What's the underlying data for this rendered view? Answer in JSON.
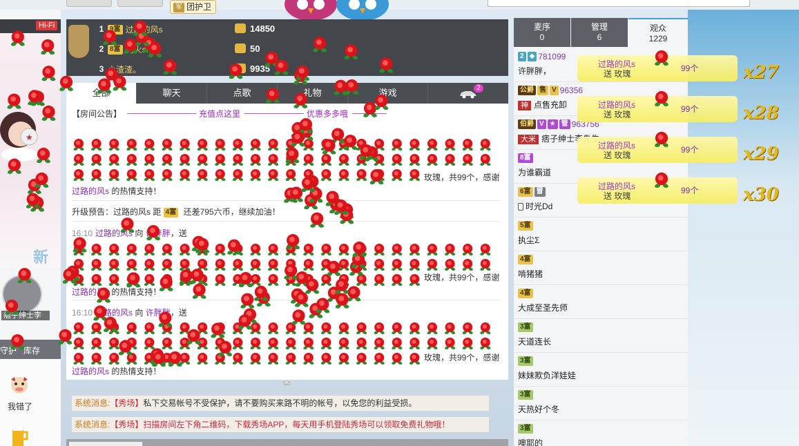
{
  "header": {
    "guard_label": "团护卫",
    "hifi_label": "Hi-Fi"
  },
  "ranking": [
    {
      "rank": "1",
      "level": "9富",
      "name": "过路的风s",
      "value": "14850"
    },
    {
      "rank": "2",
      "level": "8富",
      "name": "阿火sh",
      "value": "50"
    },
    {
      "rank": "3",
      "level": "",
      "name": "小渣渣。",
      "value": "9935"
    }
  ],
  "tabs": [
    "全部",
    "聊天",
    "点歌",
    "礼物",
    "游戏",
    ""
  ],
  "tab_badge": "2",
  "chat": {
    "notice_label": "【房间公告】",
    "notice_link1": "充值点这里",
    "notice_link2": "优惠多多哦",
    "messages": [
      {
        "tail": "玫瑰，共99个，感谢",
        "thanks_user": "过路的风s",
        "thanks_text": " 的热情支持！"
      },
      {
        "time": "16:10",
        "user": "过路的风s",
        "action": " 向 ",
        "target": "许胖胖",
        "verb": "，送",
        "tail": "玫瑰，共99个，感谢",
        "thanks_user": "过路的风s",
        "thanks_text": " 的热情支持！"
      },
      {
        "time": "16:10",
        "user": "过路的风s",
        "action": " 向 ",
        "target": "许胖胖",
        "verb": "，送",
        "tail": "玫瑰，共99个，感谢",
        "thanks_user": "过路的风s",
        "thanks_text": " 的热情支持！"
      }
    ],
    "upgrade_prefix": "升级预告：过路的风s 距 ",
    "upgrade_level": "4富",
    "upgrade_suffix": " 还差795六币，继续加油！"
  },
  "system_messages": [
    {
      "label": "系统消息:",
      "tag": "【秀场】",
      "body": "私下交易帐号不受保护，请不要购买来路不明的帐号，以免您的利益受损。"
    },
    {
      "label": "系统消息:",
      "tag": "【秀场】",
      "body": "扫描房间左下角二维码，下载秀场APP，每天用手机登陆秀场可以领取免费礼物哦！"
    }
  ],
  "left": {
    "mic_name": "痞子绅士李",
    "xin": "新",
    "bar_items": [
      "守护",
      "库存"
    ],
    "action_label": "我错了"
  },
  "right_tabs": [
    {
      "label": "麦序",
      "count": "0"
    },
    {
      "label": "管理",
      "count": "6"
    },
    {
      "label": "观众",
      "count": "1229"
    }
  ],
  "audience": [
    {
      "badges": [
        {
          "t": "2",
          "c": "b-teal"
        },
        {
          "t": "◆",
          "c": "b-teal"
        }
      ],
      "id": "781099",
      "name": "许胖胖，"
    },
    {
      "badges": [
        {
          "t": "公爵",
          "c": "b-dark"
        },
        {
          "t": "售",
          "c": "b-gold"
        },
        {
          "t": "V",
          "c": "b-gold"
        }
      ],
      "id": "96356",
      "banner": "神",
      "name": "点售充卸"
    },
    {
      "badges": [
        {
          "t": "伯爵",
          "c": "b-dark"
        },
        {
          "t": "V",
          "c": "b-purple"
        },
        {
          "t": "★",
          "c": "b-purple"
        },
        {
          "t": "管",
          "c": "b-purple"
        }
      ],
      "id": "963756",
      "banner": "大米",
      "name": "痞子绅士李先生"
    },
    {
      "badges": [
        {
          "t": "8富",
          "c": "b-purple"
        }
      ],
      "id": "",
      "name": "为谁霸道"
    },
    {
      "badges": [
        {
          "t": "6富",
          "c": "b-gold"
        },
        {
          "t": "冒",
          "c": "b-gray"
        }
      ],
      "id": "",
      "phone": true,
      "name": "时光Dd"
    },
    {
      "badges": [
        {
          "t": "5富",
          "c": "b-gold"
        }
      ],
      "id": "",
      "name": "执尘Σ"
    },
    {
      "badges": [
        {
          "t": "4富",
          "c": "b-gold"
        }
      ],
      "id": "",
      "name": "啃猪猪"
    },
    {
      "badges": [
        {
          "t": "4富",
          "c": "b-gold"
        }
      ],
      "id": "",
      "name": "大成至圣先师"
    },
    {
      "badges": [
        {
          "t": "3富",
          "c": "b-green"
        }
      ],
      "id": "",
      "name": "天道连长"
    },
    {
      "badges": [
        {
          "t": "3富",
          "c": "b-green"
        }
      ],
      "id": "",
      "name": "妹妹欺负洋娃娃"
    },
    {
      "badges": [
        {
          "t": "3富",
          "c": "b-green"
        }
      ],
      "id": "",
      "name": "天热好个冬"
    },
    {
      "badges": [
        {
          "t": "3富",
          "c": "b-green"
        }
      ],
      "id": "",
      "name": "噢耶的"
    }
  ],
  "gift_banners": [
    {
      "name": "过路的风s",
      "send": "送 玫瑰",
      "count": "99个",
      "combo": "x27"
    },
    {
      "name": "过路的风s",
      "send": "送 玫瑰",
      "count": "99个",
      "combo": "x28"
    },
    {
      "name": "过路的风s",
      "send": "送 玫瑰",
      "count": "99个",
      "combo": "x29"
    },
    {
      "name": "过路的风s",
      "send": "送 玫瑰",
      "count": "99个",
      "combo": "x30"
    }
  ],
  "colors": {
    "rose": "#d8141a",
    "accent": "#3da0d6",
    "username": "#8a2bb8"
  }
}
